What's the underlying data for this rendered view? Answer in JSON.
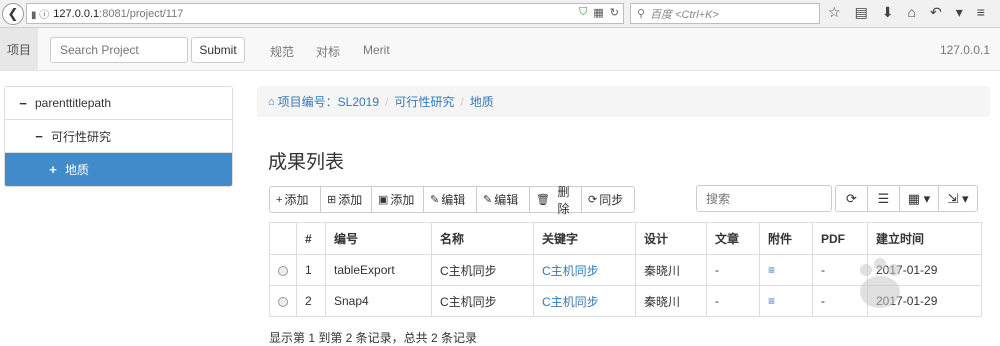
{
  "browser": {
    "url_host": "127.0.0.1",
    "url_path": ":8081/project/117",
    "search_placeholder": "百度 <Ctrl+K>"
  },
  "navbar": {
    "brand": "项目",
    "search_placeholder": "Search Project",
    "submit_label": "Submit",
    "links": [
      "规范",
      "对标",
      "Merit"
    ],
    "ip": "127.0.0.1"
  },
  "tree": {
    "items": [
      {
        "sign": "−",
        "label": "parenttitlepath"
      },
      {
        "sign": "−",
        "label": "可行性研究"
      },
      {
        "sign": "+",
        "label": "地质"
      }
    ]
  },
  "breadcrumb": {
    "project": "项目编号：SL2019",
    "level1": "可行性研究",
    "level2": "地质",
    "separator": "/"
  },
  "page_title": "成果列表",
  "toolbar": {
    "buttons": [
      {
        "icon": "plus-icon",
        "glyph": "+",
        "label": "添加"
      },
      {
        "icon": "plus-square-icon",
        "glyph": "⊞",
        "label": "添加"
      },
      {
        "icon": "plus-box-icon",
        "glyph": "▣",
        "label": "添加"
      },
      {
        "icon": "edit-icon",
        "glyph": "✎",
        "label": "编辑"
      },
      {
        "icon": "edit-icon",
        "glyph": "✎",
        "label": "编辑"
      },
      {
        "icon": "trash-icon",
        "glyph": "🗑",
        "label": "删除"
      },
      {
        "icon": "sync-icon",
        "glyph": "⟳",
        "label": "同步"
      }
    ],
    "search_placeholder": "搜索",
    "tools": [
      {
        "icon": "refresh-icon",
        "glyph": "⟳"
      },
      {
        "icon": "list-icon",
        "glyph": "☰"
      },
      {
        "icon": "columns-icon",
        "glyph": "▦ ▾"
      },
      {
        "icon": "export-icon",
        "glyph": "⇲ ▾"
      }
    ]
  },
  "table": {
    "headers": [
      "",
      "#",
      "编号",
      "名称",
      "关键字",
      "设计",
      "文章",
      "附件",
      "PDF",
      "建立时间"
    ],
    "rows": [
      {
        "index": "1",
        "code": "tableExport",
        "name": "C主机同步",
        "keyword": "C主机同步",
        "designer": "秦晓川",
        "article": "-",
        "attachment": "≡",
        "pdf": "-",
        "created": "2017-01-29"
      },
      {
        "index": "2",
        "code": "Snap4",
        "name": "C主机同步",
        "keyword": "C主机同步",
        "designer": "秦晓川",
        "article": "-",
        "attachment": "≡",
        "pdf": "-",
        "created": "2017-01-29"
      }
    ]
  },
  "footer_info": "显示第 1 到第 2 条记录，总共 2 条记录"
}
